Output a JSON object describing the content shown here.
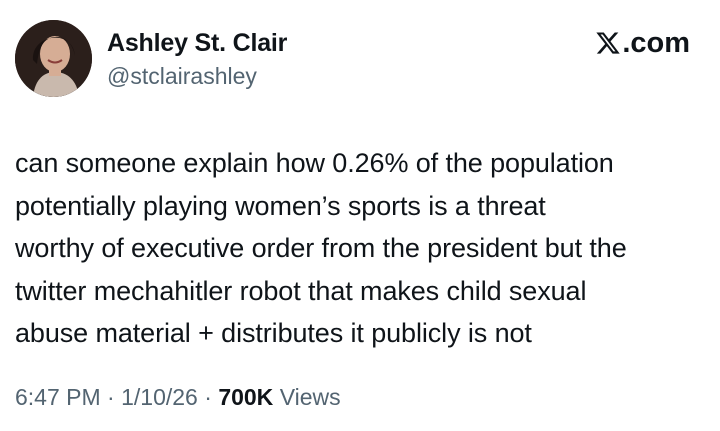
{
  "author": {
    "name": "Ashley St. Clair",
    "handle": "@stclairashley"
  },
  "brand": {
    "icon": "x-logo-icon",
    "suffix": ".com"
  },
  "tweet": {
    "lines": [
      "can someone explain how 0.26% of the population",
      "potentially playing women’s sports is a threat",
      "worthy of executive order from the president but the",
      "twitter mechahitler robot that makes child sexual",
      "abuse material + distributes it publicly is not"
    ]
  },
  "meta": {
    "time": "6:47 PM",
    "separator": " · ",
    "date": "1/10/26",
    "views_count": "700K",
    "views_label": "Views"
  },
  "colors": {
    "text": "#0f1419",
    "secondary": "#536471",
    "background": "#ffffff"
  }
}
